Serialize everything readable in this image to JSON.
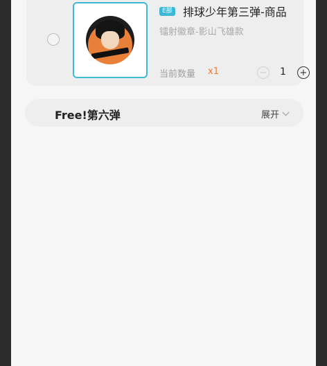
{
  "product": {
    "tag": "E部",
    "title": "排球少年第三弹-商品",
    "subtitle": "镭射徽章-影山飞雄款",
    "qty_label": "当前数量",
    "qty_mult": "x1",
    "stepper_value": "1",
    "stepper_minus": "−",
    "stepper_plus": "+"
  },
  "series": {
    "title": "Free!第六弹",
    "expand_label": "展开"
  },
  "colors": {
    "accent": "#3fb8d8",
    "orange": "#f07a2a"
  },
  "icons": {
    "radio": "radio-circle-icon",
    "minus": "minus-circle-icon",
    "plus": "plus-circle-icon",
    "chevron": "chevron-down-icon"
  }
}
